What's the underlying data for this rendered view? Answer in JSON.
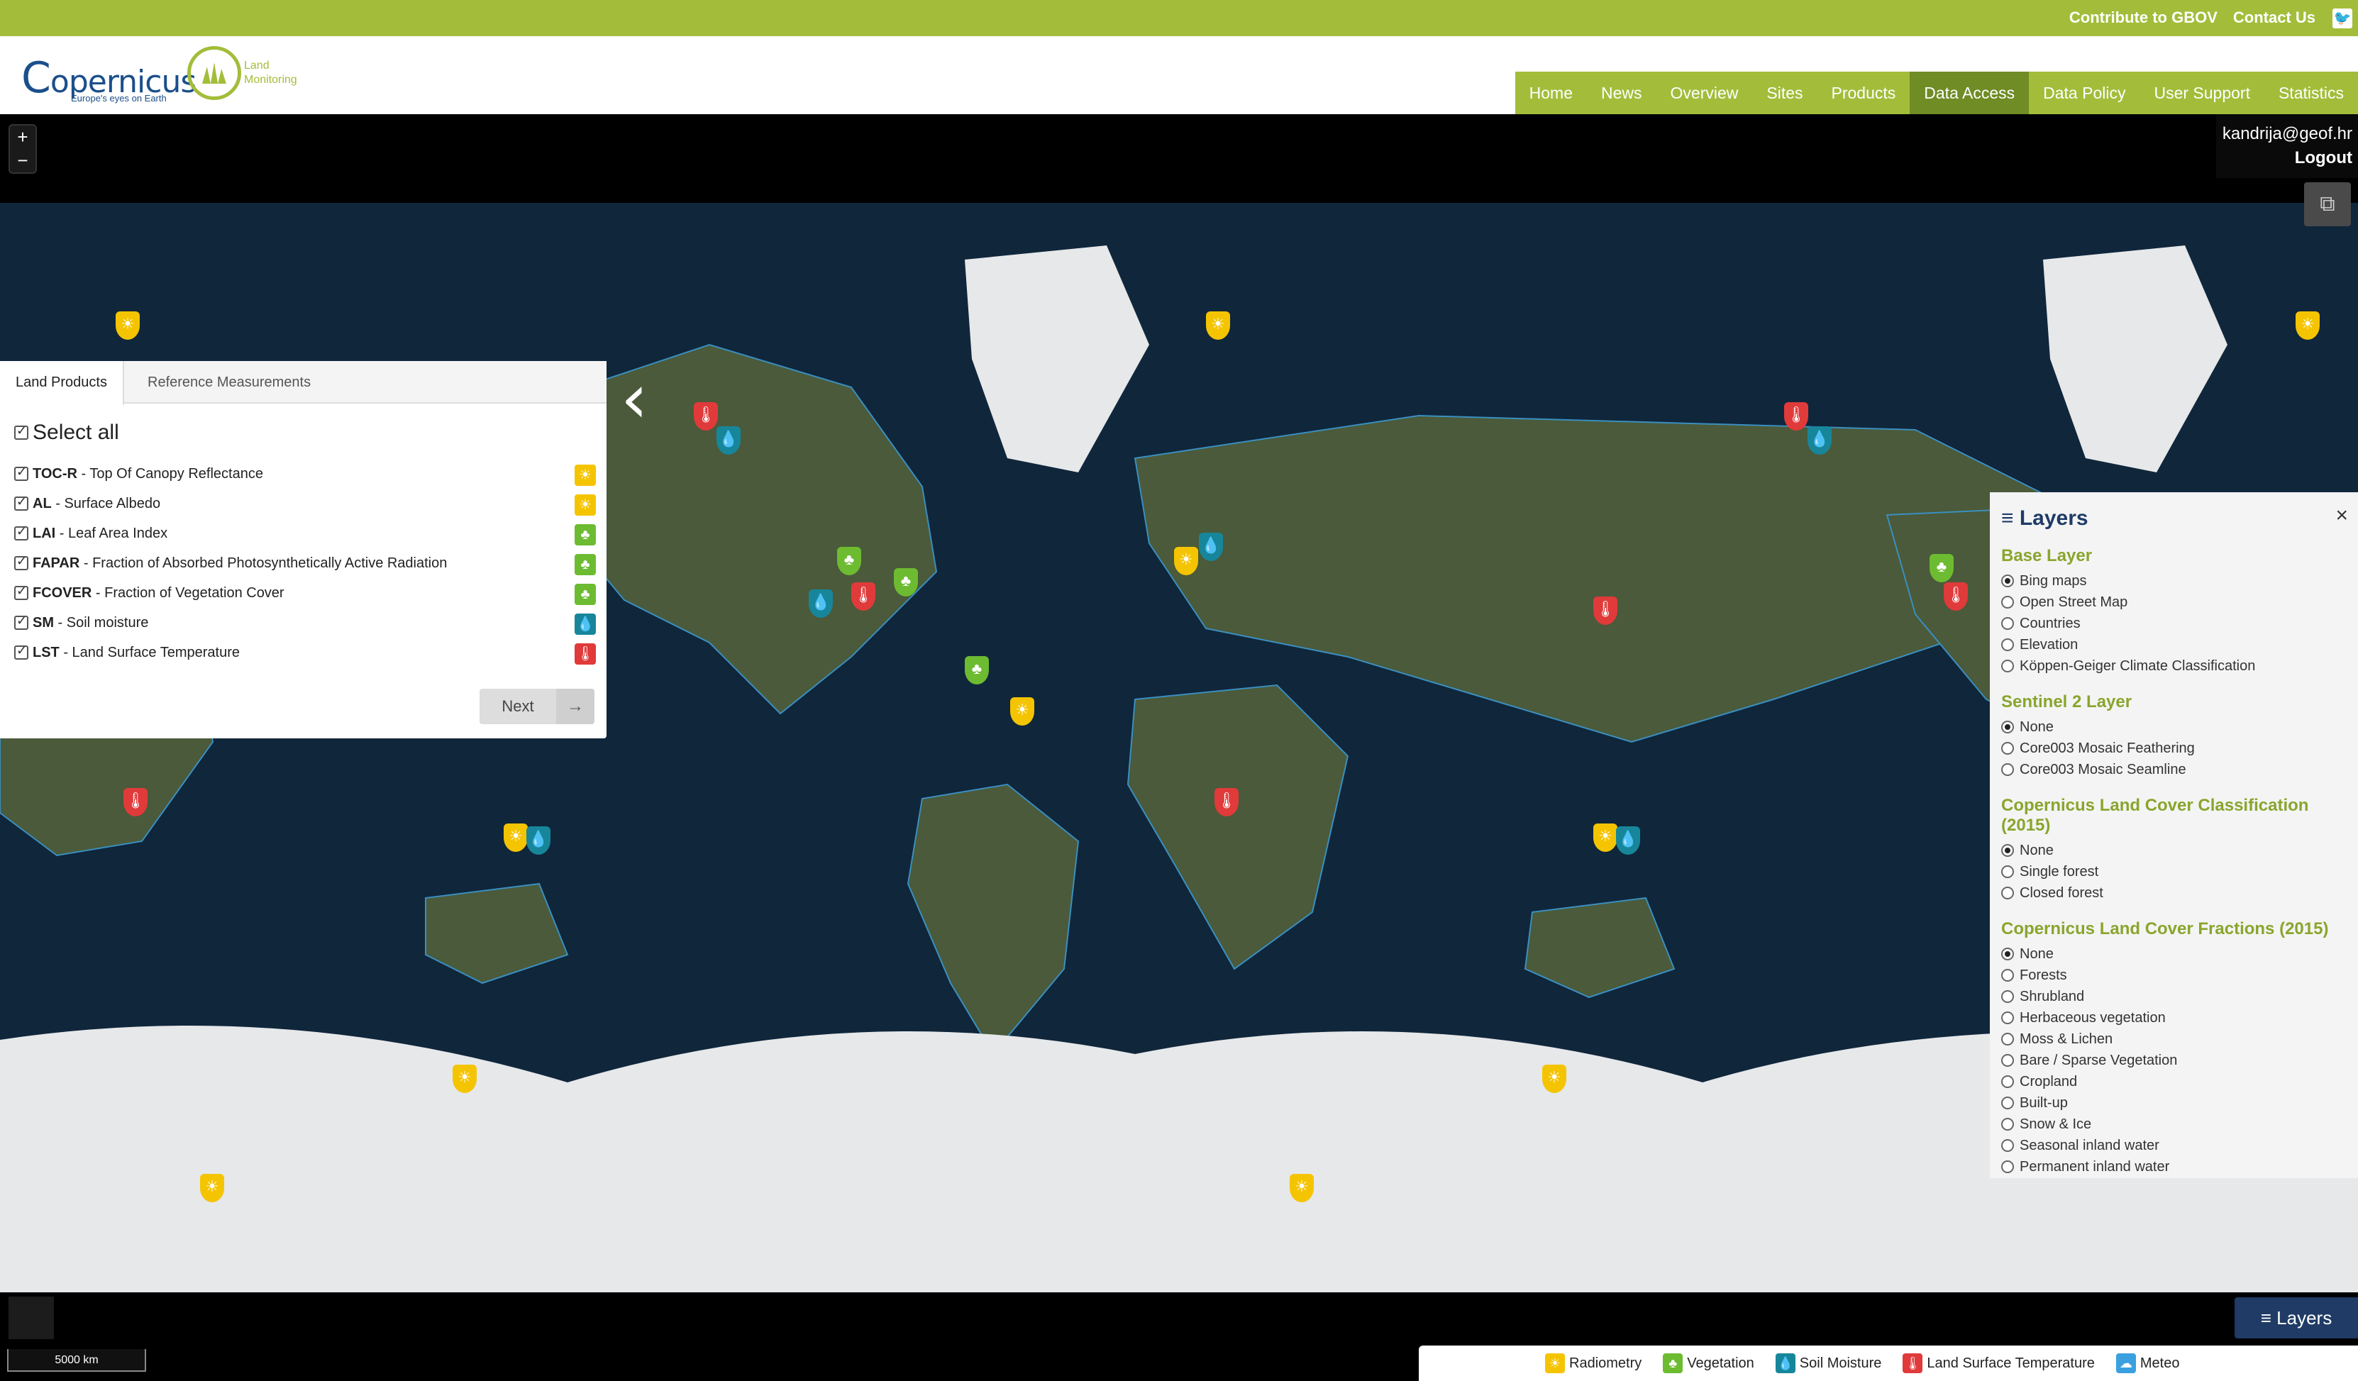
{
  "topbar": {
    "contribute": "Contribute to GBOV",
    "contact": "Contact Us"
  },
  "logos": {
    "copernicus": "opernicus",
    "copernicus_c": "C",
    "copernicus_tag": "Europe's eyes on Earth",
    "land_line1": "Land",
    "land_line2": "Monitoring"
  },
  "nav": [
    "Home",
    "News",
    "Overview",
    "Sites",
    "Products",
    "Data Access",
    "Data Policy",
    "User Support",
    "Statistics"
  ],
  "nav_active": "Data Access",
  "user": {
    "email": "kandrija@geof.hr",
    "logout": "Logout"
  },
  "panel": {
    "tabs": [
      "Land Products",
      "Reference Measurements"
    ],
    "select_all": "Select all",
    "items": [
      {
        "code": "TOC-R",
        "desc": " - Top Of Canopy Reflectance",
        "color": "#f5c400",
        "icon": "sun-icon"
      },
      {
        "code": "AL",
        "desc": " - Surface Albedo",
        "color": "#f5c400",
        "icon": "sun-icon"
      },
      {
        "code": "LAI",
        "desc": " - Leaf Area Index",
        "color": "#6dbb31",
        "icon": "tree-icon"
      },
      {
        "code": "FAPAR",
        "desc": " - Fraction of Absorbed Photosynthetically Active Radiation",
        "color": "#6dbb31",
        "icon": "tree-icon"
      },
      {
        "code": "FCOVER",
        "desc": " - Fraction of Vegetation Cover",
        "color": "#6dbb31",
        "icon": "tree-icon"
      },
      {
        "code": "SM",
        "desc": " - Soil moisture",
        "color": "#17869a",
        "icon": "droplet-icon"
      },
      {
        "code": "LST",
        "desc": " - Land Surface Temperature",
        "color": "#e03a3a",
        "icon": "thermometer-icon"
      }
    ],
    "next": "Next"
  },
  "layers": {
    "title": "Layers",
    "groups": [
      {
        "title": "Base Layer",
        "options": [
          "Bing maps",
          "Open Street Map",
          "Countries",
          "Elevation",
          "Köppen-Geiger Climate Classification"
        ],
        "selected": 0
      },
      {
        "title": "Sentinel 2 Layer",
        "options": [
          "None",
          "Core003 Mosaic Feathering",
          "Core003 Mosaic Seamline"
        ],
        "selected": 0
      },
      {
        "title": "Copernicus Land Cover Classification (2015)",
        "options": [
          "None",
          "Single forest",
          "Closed forest"
        ],
        "selected": 0
      },
      {
        "title": "Copernicus Land Cover Fractions (2015)",
        "options": [
          "None",
          "Forests",
          "Shrubland",
          "Herbaceous vegetation",
          "Moss & Lichen",
          "Bare / Sparse Vegetation",
          "Cropland",
          "Built-up",
          "Snow & Ice",
          "Seasonal inland water",
          "Permanent inland water"
        ],
        "selected": 0
      }
    ],
    "button": "Layers"
  },
  "scale": "5000 km",
  "legend": [
    {
      "label": "Radiometry",
      "color": "#f5c400",
      "icon": "sun-icon"
    },
    {
      "label": "Vegetation",
      "color": "#6dbb31",
      "icon": "tree-icon"
    },
    {
      "label": "Soil Moisture",
      "color": "#17869a",
      "icon": "droplet-icon"
    },
    {
      "label": "Land Surface Temperature",
      "color": "#e03a3a",
      "icon": "thermometer-icon"
    },
    {
      "label": "Meteo",
      "color": "#3aa0e0",
      "icon": "cloud-icon"
    }
  ]
}
